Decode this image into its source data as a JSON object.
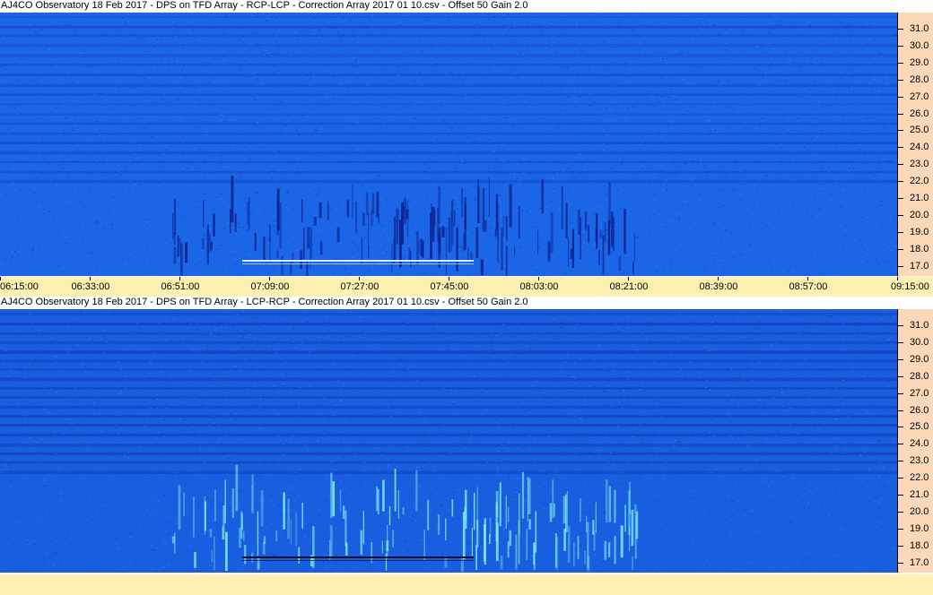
{
  "panels": [
    {
      "title": "AJ4CO Observatory 18 Feb 2017  -  DPS on TFD Array  -  RCP-LCP  -  Correction Array 2017 01 10.csv  -  Offset 50  Gain 2.0",
      "polarity": "RCP-LCP",
      "colors": {
        "background": "#1a66e6",
        "band_dark": "#1446c8",
        "burst": "#0a1e8c",
        "trace": "#ffffff"
      }
    },
    {
      "title": "AJ4CO Observatory 18 Feb 2017  -  DPS on TFD Array  -  LCP-RCP  -  Correction Array 2017 01 10.csv  -  Offset 50  Gain 2.0",
      "polarity": "LCP-RCP",
      "colors": {
        "background": "#1a5ee0",
        "band_dark": "#1238b0",
        "burst": "#7ff0f0",
        "trace": "#000000"
      }
    }
  ],
  "frequency_labels": [
    "31.0",
    "30.0",
    "29.0",
    "28.0",
    "27.0",
    "26.0",
    "25.0",
    "24.0",
    "23.0",
    "22.0",
    "21.0",
    "20.0",
    "19.0",
    "18.0",
    "17.0"
  ],
  "time_labels": [
    "06:15:00",
    "06:33:00",
    "06:51:00",
    "07:09:00",
    "07:27:00",
    "07:45:00",
    "08:03:00",
    "08:21:00",
    "08:39:00",
    "08:57:00",
    "09:15:00"
  ]
}
